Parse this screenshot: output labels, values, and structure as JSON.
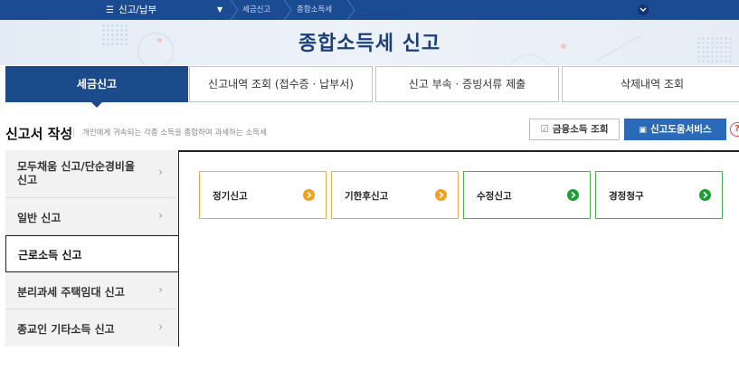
{
  "topnav": {
    "menu_label": "신고/납부",
    "breadcrumb": [
      "세금신고",
      "종합소득세"
    ]
  },
  "hero": {
    "title": "종합소득세 신고"
  },
  "tabs": [
    {
      "label": "세금신고",
      "active": true
    },
    {
      "label": "신고내역 조회 (접수증 · 납부서)",
      "active": false
    },
    {
      "label": "신고 부속 · 증빙서류 제출",
      "active": false
    },
    {
      "label": "삭제내역 조회",
      "active": false
    }
  ],
  "section": {
    "title": "신고서 작성",
    "description": "개인에게 귀속되는 각종 소득을 종합하여 과세하는 소득세",
    "financial_income_button": "금융소득 조회",
    "help_service_button": "신고도움서비스"
  },
  "sidebar": {
    "items": [
      {
        "label": "모두채움 신고/단순경비율 신고",
        "active": false
      },
      {
        "label": "일반 신고",
        "active": false
      },
      {
        "label": "근로소득 신고",
        "active": true
      },
      {
        "label": "분리과세 주택임대 신고",
        "active": false
      },
      {
        "label": "종교인 기타소득 신고",
        "active": false
      }
    ]
  },
  "cards": [
    {
      "label": "정기신고",
      "color": "#f1a11f"
    },
    {
      "label": "기한후신고",
      "color": "#f1a11f"
    },
    {
      "label": "수정신고",
      "color": "#18a035"
    },
    {
      "label": "경정청구",
      "color": "#18a035"
    }
  ],
  "colors": {
    "nav_bg": "#1a4b93",
    "accent": "#1c4b8c",
    "primary_button": "#2a6ab8"
  }
}
